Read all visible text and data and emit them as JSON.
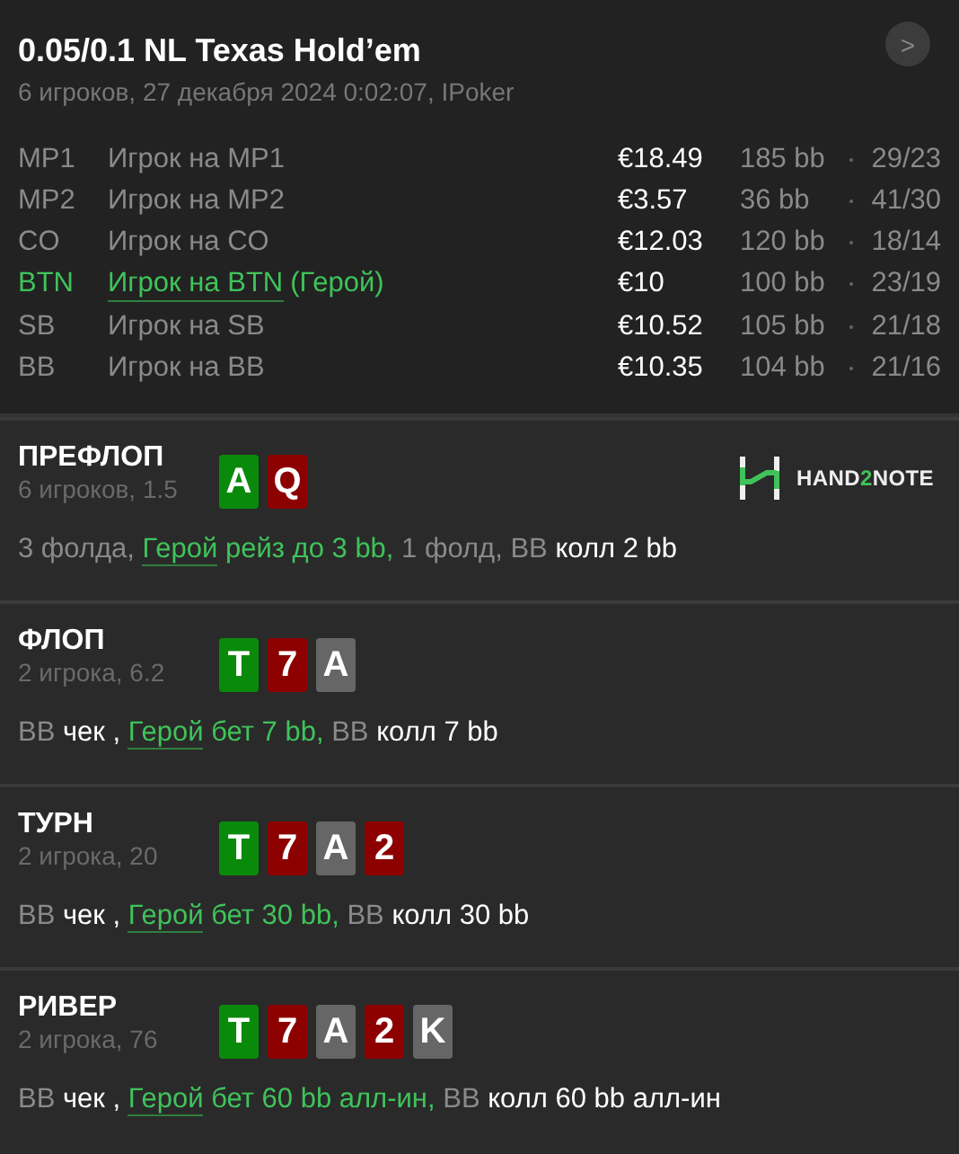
{
  "header": {
    "title": "0.05/0.1 NL Texas Hold’em",
    "subtitle": "6 игроков, 27 декабря 2024 0:02:07, IPoker",
    "next_button": ">"
  },
  "players": [
    {
      "position": "MP1",
      "name": "Игрок на MP1",
      "hero": false,
      "stack": "€18.49",
      "bb": "185 bb",
      "stats": "29/23"
    },
    {
      "position": "MP2",
      "name": "Игрок на MP2",
      "hero": false,
      "stack": "€3.57",
      "bb": "36 bb",
      "stats": "41/30"
    },
    {
      "position": "CO",
      "name": "Игрок на CO",
      "hero": false,
      "stack": "€12.03",
      "bb": "120 bb",
      "stats": "18/14"
    },
    {
      "position": "BTN",
      "name": "Игрок на BTN",
      "hero": true,
      "hero_tag": "(Герой)",
      "stack": "€10",
      "bb": "100 bb",
      "stats": "23/19"
    },
    {
      "position": "SB",
      "name": "Игрок на SB",
      "hero": false,
      "stack": "€10.52",
      "bb": "105 bb",
      "stats": "21/18"
    },
    {
      "position": "BB",
      "name": "Игрок на BB",
      "hero": false,
      "stack": "€10.35",
      "bb": "104 bb",
      "stats": "21/16"
    }
  ],
  "logo": {
    "parts": [
      "HAND",
      "2",
      "NOTE"
    ]
  },
  "streets": [
    {
      "name": "ПРЕФЛОП",
      "info": "6 игроков, 1.5",
      "cards": [
        {
          "rank": "A",
          "color": "#0a8a0a"
        },
        {
          "rank": "Q",
          "color": "#8c0000"
        }
      ],
      "actions": [
        {
          "kind": "muted",
          "text": "3 фолда, "
        },
        {
          "kind": "hero-link",
          "text": "Герой"
        },
        {
          "kind": "hero",
          "text": " рейз до 3 bb,"
        },
        {
          "kind": "muted",
          "text": " 1 фолд, BB "
        },
        {
          "kind": "plain",
          "text": "колл 2 bb"
        }
      ]
    },
    {
      "name": "ФЛОП",
      "info": "2 игрока, 6.2",
      "cards": [
        {
          "rank": "T",
          "color": "#0a8a0a"
        },
        {
          "rank": "7",
          "color": "#8c0000"
        },
        {
          "rank": "A",
          "color": "#666666"
        }
      ],
      "actions": [
        {
          "kind": "muted",
          "text": "BB "
        },
        {
          "kind": "plain",
          "text": "чек , "
        },
        {
          "kind": "hero-link",
          "text": "Герой"
        },
        {
          "kind": "hero",
          "text": " бет 7 bb,"
        },
        {
          "kind": "muted",
          "text": " BB "
        },
        {
          "kind": "plain",
          "text": "колл 7 bb"
        }
      ]
    },
    {
      "name": "ТУРН",
      "info": "2 игрока, 20",
      "cards": [
        {
          "rank": "T",
          "color": "#0a8a0a"
        },
        {
          "rank": "7",
          "color": "#8c0000"
        },
        {
          "rank": "A",
          "color": "#666666"
        },
        {
          "rank": "2",
          "color": "#8c0000"
        }
      ],
      "actions": [
        {
          "kind": "muted",
          "text": "BB "
        },
        {
          "kind": "plain",
          "text": "чек , "
        },
        {
          "kind": "hero-link",
          "text": "Герой"
        },
        {
          "kind": "hero",
          "text": " бет 30 bb,"
        },
        {
          "kind": "muted",
          "text": " BB "
        },
        {
          "kind": "plain",
          "text": "колл 30 bb"
        }
      ]
    },
    {
      "name": "РИВЕР",
      "info": "2 игрока, 76",
      "cards": [
        {
          "rank": "T",
          "color": "#0a8a0a"
        },
        {
          "rank": "7",
          "color": "#8c0000"
        },
        {
          "rank": "A",
          "color": "#666666"
        },
        {
          "rank": "2",
          "color": "#8c0000"
        },
        {
          "rank": "K",
          "color": "#666666"
        }
      ],
      "actions": [
        {
          "kind": "muted",
          "text": "BB "
        },
        {
          "kind": "plain",
          "text": "чек , "
        },
        {
          "kind": "hero-link",
          "text": "Герой"
        },
        {
          "kind": "hero",
          "text": " бет 60 bb алл-ин,"
        },
        {
          "kind": "muted",
          "text": " BB "
        },
        {
          "kind": "plain",
          "text": "колл 60 bb алл-ин"
        }
      ]
    }
  ]
}
